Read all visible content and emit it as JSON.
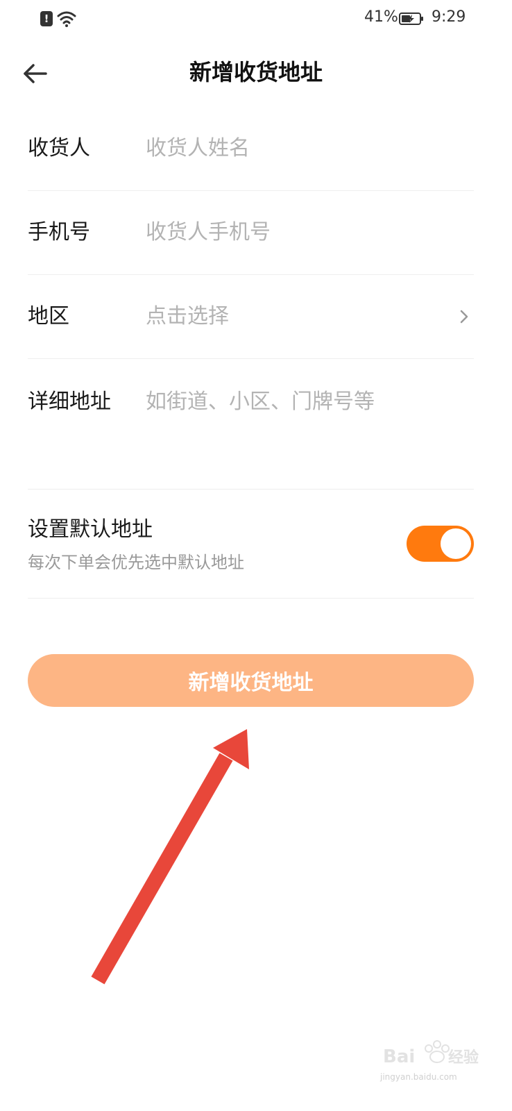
{
  "status_bar": {
    "battery_percent": "41%",
    "time": "9:29"
  },
  "header": {
    "title": "新增收货地址"
  },
  "form": {
    "rows": [
      {
        "label": "收货人",
        "placeholder": "收货人姓名"
      },
      {
        "label": "手机号",
        "placeholder": "收货人手机号"
      },
      {
        "label": "地区",
        "placeholder": "点击选择"
      },
      {
        "label": "详细地址",
        "placeholder": "如街道、小区、门牌号等"
      }
    ]
  },
  "default_address": {
    "title": "设置默认地址",
    "subtitle": "每次下单会优先选中默认地址",
    "enabled": true
  },
  "submit": {
    "label": "新增收货地址"
  },
  "watermark": {
    "brand": "Baidu 经验",
    "url": "jingyan.baidu.com"
  },
  "colors": {
    "accent": "#ff7a0e",
    "button_bg": "#fdb584",
    "arrow": "#e8473a"
  }
}
